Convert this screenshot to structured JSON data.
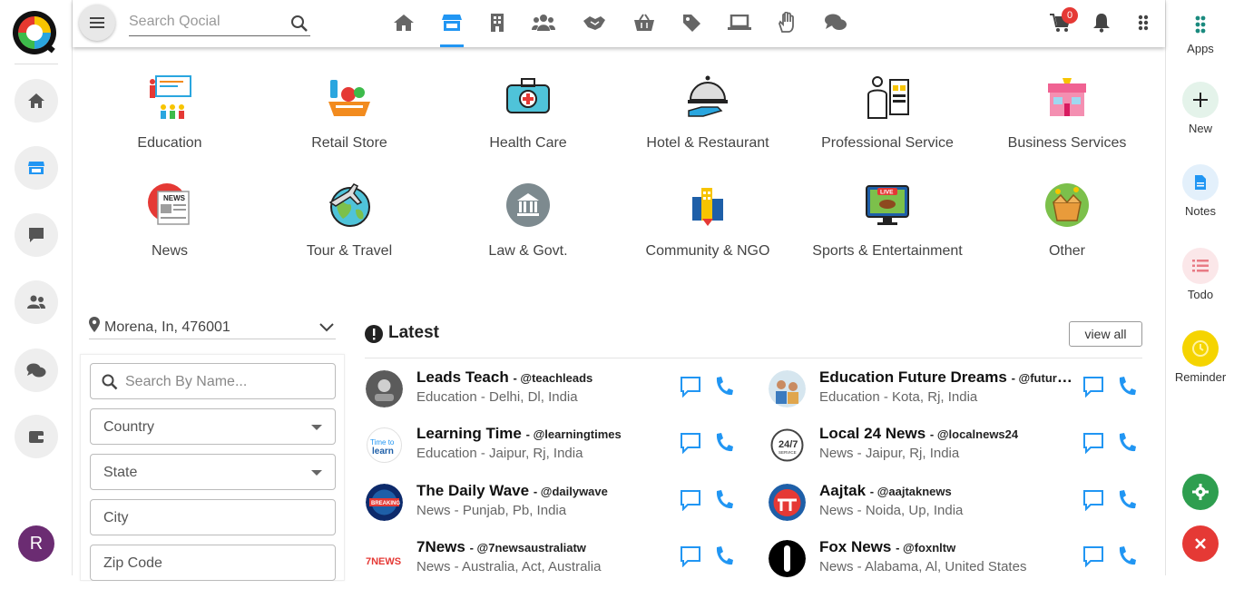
{
  "topbar": {
    "search_placeholder": "Search Qocial",
    "cart_count": "0",
    "nav_icons": [
      "home-icon",
      "store-icon",
      "building-icon",
      "people-icon",
      "handshake-icon",
      "basket-icon",
      "tags-icon",
      "laptop-icon",
      "hand-icon",
      "chat-icon"
    ],
    "active_nav": "store-icon"
  },
  "left_rail": {
    "items": [
      "home-icon",
      "store-icon",
      "comment-icon",
      "users-icon",
      "comments-icon",
      "wallet-icon"
    ],
    "avatar_initial": "R"
  },
  "right_rail": {
    "apps": "Apps",
    "new": "New",
    "notes": "Notes",
    "todo": "Todo",
    "reminder": "Reminder"
  },
  "categories": [
    {
      "label": "Education",
      "icon": "education-icon"
    },
    {
      "label": "Retail Store",
      "icon": "retail-store-icon"
    },
    {
      "label": "Health Care",
      "icon": "health-care-icon"
    },
    {
      "label": "Hotel & Restaurant",
      "icon": "hotel-restaurant-icon"
    },
    {
      "label": "Professional Service",
      "icon": "professional-service-icon"
    },
    {
      "label": "Business Services",
      "icon": "business-services-icon"
    },
    {
      "label": "News",
      "icon": "news-icon"
    },
    {
      "label": "Tour & Travel",
      "icon": "tour-travel-icon"
    },
    {
      "label": "Law & Govt.",
      "icon": "law-govt-icon"
    },
    {
      "label": "Community & NGO",
      "icon": "community-ngo-icon"
    },
    {
      "label": "Sports & Entertainment",
      "icon": "sports-entertainment-icon"
    },
    {
      "label": "Other",
      "icon": "other-icon"
    }
  ],
  "filters": {
    "location": "Morena, In, 476001",
    "search_placeholder": "Search By Name...",
    "country": "Country",
    "state": "State",
    "city": "City",
    "zip": "Zip Code"
  },
  "latest": {
    "title": "Latest",
    "view_all": "view all",
    "entries": [
      {
        "name": "Leads Teach",
        "handle": "- @teachleads",
        "sub": "Education - Delhi, Dl, India"
      },
      {
        "name": "Education Future Dreams",
        "handle": "- @futuredreams",
        "sub": "Education - Kota, Rj, India"
      },
      {
        "name": "Learning Time",
        "handle": "- @learningtimes",
        "sub": "Education - Jaipur, Rj, India"
      },
      {
        "name": "Local 24 News",
        "handle": "- @localnews24",
        "sub": "News - Jaipur, Rj, India"
      },
      {
        "name": "The Daily Wave",
        "handle": "- @dailywave",
        "sub": "News - Punjab, Pb, India"
      },
      {
        "name": "Aajtak",
        "handle": "- @aajtaknews",
        "sub": "News - Noida, Up, India"
      },
      {
        "name": "7News",
        "handle": "- @7newsaustraliatw",
        "sub": "News - Australia, Act, Australia"
      },
      {
        "name": "Fox News",
        "handle": "- @foxnltw",
        "sub": "News - Alabama, Al, United States"
      }
    ]
  },
  "colors": {
    "accent": "#2196f3",
    "rail_bg": "#eeeeee",
    "add_btn": "#2e9e4f",
    "close_btn": "#e53935",
    "reminder": "#f5d400"
  }
}
